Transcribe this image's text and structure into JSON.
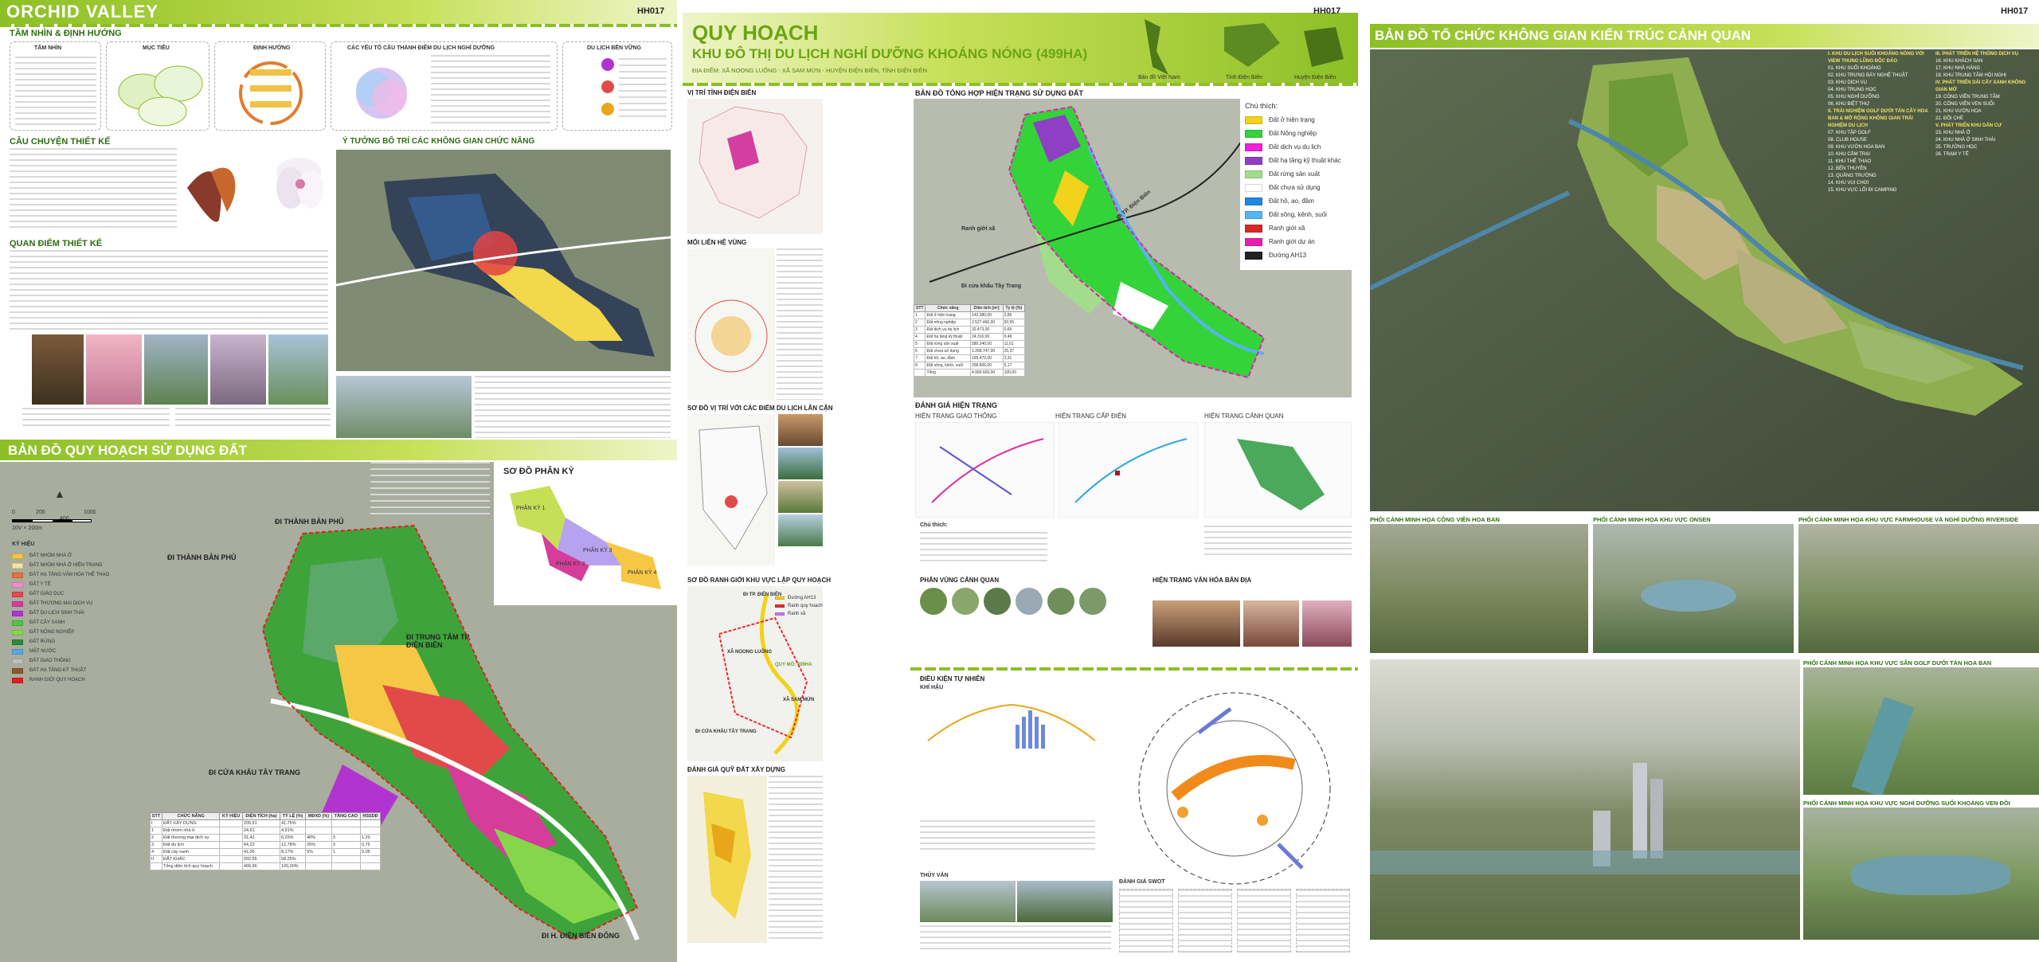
{
  "board1": {
    "title": "ORCHID VALLEY",
    "code": "HH017",
    "vision_heading": "TẦM NHÌN & ĐỊNH HƯỚNG",
    "vision_box_titles": [
      "TẦM NHÌN",
      "MỤC TIÊU",
      "ĐỊNH HƯỚNG",
      "CÁC YẾU TỐ CẤU THÀNH ĐIỂM DU LỊCH NGHỈ DƯỠNG",
      "DU LỊCH BỀN VỮNG"
    ],
    "story_heading": "CÂU CHUYỆN THIẾT KẾ",
    "viewpoint_heading": "QUAN ĐIỂM THIẾT KẾ",
    "idea_heading": "Ý TƯỞNG BỐ TRÍ CÁC KHÔNG GIAN CHỨC NĂNG",
    "landuse_heading": "BẢN ĐỒ QUY HOẠCH SỬ DỤNG ĐẤT",
    "zoning_heading": "SƠ ĐỒ PHÂN KỲ",
    "zone_labels": [
      "PHÂN KỲ 1",
      "PHÂN KỲ 2",
      "PHÂN KỲ 3",
      "PHÂN KỲ 4"
    ],
    "map_labels": {
      "tp1": "ĐI THÀNH BẢN PHỦ",
      "tp2": "ĐI THÀNH BẢN PHỦ",
      "center": "ĐI TRUNG TÂM TP. ĐIỆN BIÊN",
      "border": "ĐI CỬA KHẨU TÂY TRANG",
      "dienbien": "ĐI H. ĐIỆN BIÊN ĐÔNG"
    },
    "scale_numbers": [
      "0",
      "200",
      "400",
      "1000"
    ],
    "scale_note": "10V × 200m",
    "legend_title": "KÝ HIỆU",
    "legend": [
      {
        "label": "ĐẤT NHÓM NHÀ Ở",
        "color": "#f6c744"
      },
      {
        "label": "ĐẤT NHÓM NHÀ Ở HIỆN TRẠNG",
        "color": "#f3e6a2"
      },
      {
        "label": "ĐẤT HẠ TẦNG VĂN HÓA THỂ THAO",
        "color": "#e5733a"
      },
      {
        "label": "ĐẤT Y TẾ",
        "color": "#ef8fd0"
      },
      {
        "label": "ĐẤT GIÁO DỤC",
        "color": "#e24a4a"
      },
      {
        "label": "ĐẤT THƯƠNG MẠI DỊCH VỤ",
        "color": "#d63d9a"
      },
      {
        "label": "ĐẤT DU LỊCH SINH THÁI",
        "color": "#b234d0"
      },
      {
        "label": "ĐẤT CÂY XANH",
        "color": "#52c441"
      },
      {
        "label": "ĐẤT NÔNG NGHIỆP",
        "color": "#86d64b"
      },
      {
        "label": "ĐẤT RỪNG",
        "color": "#2e8b3a"
      },
      {
        "label": "MẶT NƯỚC",
        "color": "#5aa7e0"
      },
      {
        "label": "ĐẤT GIAO THÔNG",
        "color": "#bfbfbf"
      },
      {
        "label": "ĐẤT HẠ TẦNG KỸ THUẬT",
        "color": "#8b5a2b"
      },
      {
        "label": "RANH GIỚI QUY HOẠCH",
        "color": "#e02020"
      }
    ],
    "table_headers": [
      "STT",
      "CHỨC NĂNG",
      "KÝ HIỆU",
      "DIỆN TÍCH (ha)",
      "TỶ LỆ (%)",
      "MĐXD (%)",
      "TẦNG CAO",
      "HSSDĐ"
    ],
    "table_rows": [
      [
        "I",
        "ĐẤT XÂY DỰNG",
        "",
        "209,91",
        "41,75%",
        "",
        "",
        ""
      ],
      [
        "1",
        "Đất nhóm nhà ở",
        "",
        "24,61",
        "4,91%",
        "",
        "",
        ""
      ],
      [
        "2",
        "Đất thương mại dịch vụ",
        "",
        "31,42",
        "6,25%",
        "40%",
        "3",
        "1,20"
      ],
      [
        "3",
        "Đất du lịch",
        "",
        "64,23",
        "12,78%",
        "25%",
        "3",
        "0,75"
      ],
      [
        "4",
        "Đất cây xanh",
        "",
        "41,06",
        "8,17%",
        "5%",
        "1",
        "0,05"
      ],
      [
        "II",
        "ĐẤT KHÁC",
        "",
        "292,55",
        "58,25%",
        "",
        "",
        ""
      ],
      [
        "",
        "Tổng diện tích quy hoạch",
        "",
        "499,96",
        "100,00%",
        "",
        "",
        ""
      ]
    ]
  },
  "board2": {
    "title": "QUY HOẠCH",
    "subtitle": "KHU ĐÔ THỊ DU LỊCH NGHỈ DƯỠNG KHOÁNG NÓNG (499HA)",
    "address": "ĐỊA ĐIỂM: XÃ NOONG LUỐNG - XÃ SAM MỨN - HUYỆN ĐIỆN BIÊN, TỈNH ĐIỆN BIÊN",
    "code": "HH017",
    "map_captions": [
      "Bản đồ Việt Nam",
      "Tỉnh Điện Biên",
      "Huyện Điện Biên"
    ],
    "left_headings": [
      "VỊ TRÍ TỈNH ĐIỆN BIÊN",
      "MỐI LIÊN HỆ VÙNG",
      "SƠ ĐỒ VỊ TRÍ VỚI CÁC ĐIỂM DU LỊCH LÂN CẬN",
      "SƠ ĐỒ RANH GIỚI KHU VỰC LẬP QUY HOẠCH",
      "ĐÁNH GIÁ QUỸ ĐẤT XÂY DỰNG"
    ],
    "status_heading": "BẢN ĐỒ TỔNG HỢP HIỆN TRẠNG SỬ DỤNG ĐẤT",
    "status_legend_title": "Chú thích:",
    "status_legend": [
      {
        "label": "Đất ở hiện trạng",
        "color": "#f2d21a"
      },
      {
        "label": "Đất Nông nghiệp",
        "color": "#34d33a"
      },
      {
        "label": "Đất dịch vụ du lịch",
        "color": "#ee22d6"
      },
      {
        "label": "Đất hạ tầng kỹ thuật khác",
        "color": "#8e3fc4"
      },
      {
        "label": "Đất rừng sản xuất",
        "color": "#a3dc8c"
      },
      {
        "label": "Đất chưa sử dụng",
        "color": "#ffffff"
      },
      {
        "label": "Đất hồ, ao, đầm",
        "color": "#1f88e0"
      },
      {
        "label": "Đất sông, kênh, suối",
        "color": "#55b4f2"
      },
      {
        "label": "Ranh giới xã",
        "color": "#d22a2a"
      },
      {
        "label": "Ranh giới dự án",
        "color": "#e61fae"
      },
      {
        "label": "Đường AH13",
        "color": "#222222"
      }
    ],
    "status_map_labels": {
      "city": "Đi TP. Điện Biên",
      "border": "Đi cửa khẩu Tây Trang",
      "boundary": "Ranh giới xã"
    },
    "eval_heading": "ĐÁNH GIÁ HIỆN TRẠNG",
    "eval_sub": [
      "HIỆN TRẠNG GIAO THÔNG",
      "HIỆN TRẠNG CẤP ĐIỆN",
      "HIỆN TRẠNG CẢNH QUAN"
    ],
    "eval_legend_title": "Chú thích:",
    "landscape_heading": "PHÂN VÙNG CẢNH QUAN",
    "culture_heading": "HIỆN TRẠNG VĂN HÓA BẢN ĐỊA",
    "nature_heading": "ĐIỀU KIỆN TỰ NHIÊN",
    "climate_label": "KHÍ HẬU",
    "hydro_label": "THỦY VĂN",
    "swot_label": "ĐÁNH GIÁ SWOT",
    "small_map_labels": {
      "dienbien": "ĐI TP. ĐIỆN BIÊN",
      "noong": "XÃ NOONG LUỐNG",
      "sam": "XÃ SAM MỨN",
      "taytrang": "ĐI CỬA KHẨU TÂY TRANG",
      "qd": "QUY MÔ: 499HA",
      "road": "ĐƯỜNG AH13"
    },
    "boundary_legend": [
      {
        "label": "Đường AH13",
        "color": "#f2d21a"
      },
      {
        "label": "Ranh quy hoạch",
        "color": "#e82e2e"
      },
      {
        "label": "Ranh xã",
        "color": "#c97be0"
      }
    ],
    "table_headers": [
      "STT",
      "Chức năng",
      "Diện tích (m²)",
      "Tỷ lệ (%)"
    ],
    "table_rows": [
      [
        "1",
        "Đất ở hiện trạng",
        "142.380,00",
        "2,85"
      ],
      [
        "2",
        "Đất nông nghiệp",
        "2.527.466,00",
        "50,55"
      ],
      [
        "3",
        "Đất dịch vụ du lịch",
        "32.473,00",
        "0,65"
      ],
      [
        "4",
        "Đất hạ tầng kỹ thuật",
        "24.316,00",
        "0,49"
      ],
      [
        "5",
        "Đất rừng sản xuất",
        "580.340,00",
        "11,61"
      ],
      [
        "6",
        "Đất chưa sử dụng",
        "1.268.747,00",
        "25,37"
      ],
      [
        "7",
        "Đất hồ, ao, đầm",
        "165.472,00",
        "3,31"
      ],
      [
        "8",
        "Đất sông, kênh, suối",
        "258.806,00",
        "5,17"
      ],
      [
        "",
        "Tổng",
        "4.999.600,00",
        "100,00"
      ]
    ]
  },
  "board3": {
    "title": "BẢN ĐỒ TỔ CHỨC KHÔNG GIAN KIẾN TRÚC CẢNH QUAN",
    "code": "HH017",
    "list_col1": [
      "I. KHU DU LỊCH SUỐI KHOÁNG NÓNG VỚI VIEW THUNG LŨNG ĐỘC ĐÁO",
      "01. KHU SUỐI KHOÁNG",
      "02. KHU TRƯNG BÀY NGHỆ THUẬT",
      "03. KHU DỊCH VỤ",
      "04. KHU TRUNG HỌC",
      "05. KHU NGHỈ DƯỠNG",
      "06. KHU BIỆT THỰ",
      "II. TRẢI NGHIỆM GOLF DƯỚI TÁN CÂY HOA BAN & MỞ RỘNG KHÔNG GIAN TRẢI NGHIỆM DU LỊCH",
      "07. KHU TẬP GOLF",
      "08. CLUB HOUSE",
      "09. KHU VƯỜN HOA BAN",
      "10. KHU CẮM TRẠI",
      "11. KHU THỂ THAO",
      "12. BẾN THUYỀN",
      "13. QUẢNG TRƯỜNG",
      "14. KHU VUI CHƠI",
      "15. KHU VỰC LỐI ĐI CAMPING"
    ],
    "list_col2": [
      "III. PHÁT TRIỂN HỆ THỐNG DỊCH VỤ",
      "16. KHU KHÁCH SẠN",
      "17. KHU NHÀ HÀNG",
      "18. KHU TRUNG TÂM HỘI NGHỊ",
      "IV. PHÁT TRIỂN DẢI CÂY XANH KHÔNG GIAN MỞ",
      "19. CÔNG VIÊN TRUNG TÂM",
      "20. CÔNG VIÊN VEN SUỐI",
      "21. KHU VƯỜN HOA",
      "22. ĐỒI CHÈ",
      "V. PHÁT TRIỂN KHU DÂN CƯ",
      "23. KHU NHÀ Ở",
      "24. KHU NHÀ Ở SINH THÁI",
      "25. TRƯỜNG HỌC",
      "26. TRẠM Y TẾ"
    ],
    "captions": [
      "PHỐI CẢNH MINH HỌA CÔNG VIÊN HOA BAN",
      "PHỐI CẢNH MINH HỌA KHU VỰC ONSEN",
      "PHỐI CẢNH MINH HỌA KHU VỰC FARMHOUSE VÀ NGHỈ DƯỠNG RIVERSIDE",
      "PHỐI CẢNH MINH HỌA KHU VỰC SÂN GOLF DƯỚI TÁN HOA BAN",
      "PHỐI CẢNH MINH HỌA KHU VỰC NGHỈ DƯỠNG SUỐI KHOÁNG VEN ĐỒI"
    ]
  },
  "colors": {
    "accent": "#8cbf26",
    "dark_green": "#2d6e11",
    "lime": "#c7df57"
  }
}
